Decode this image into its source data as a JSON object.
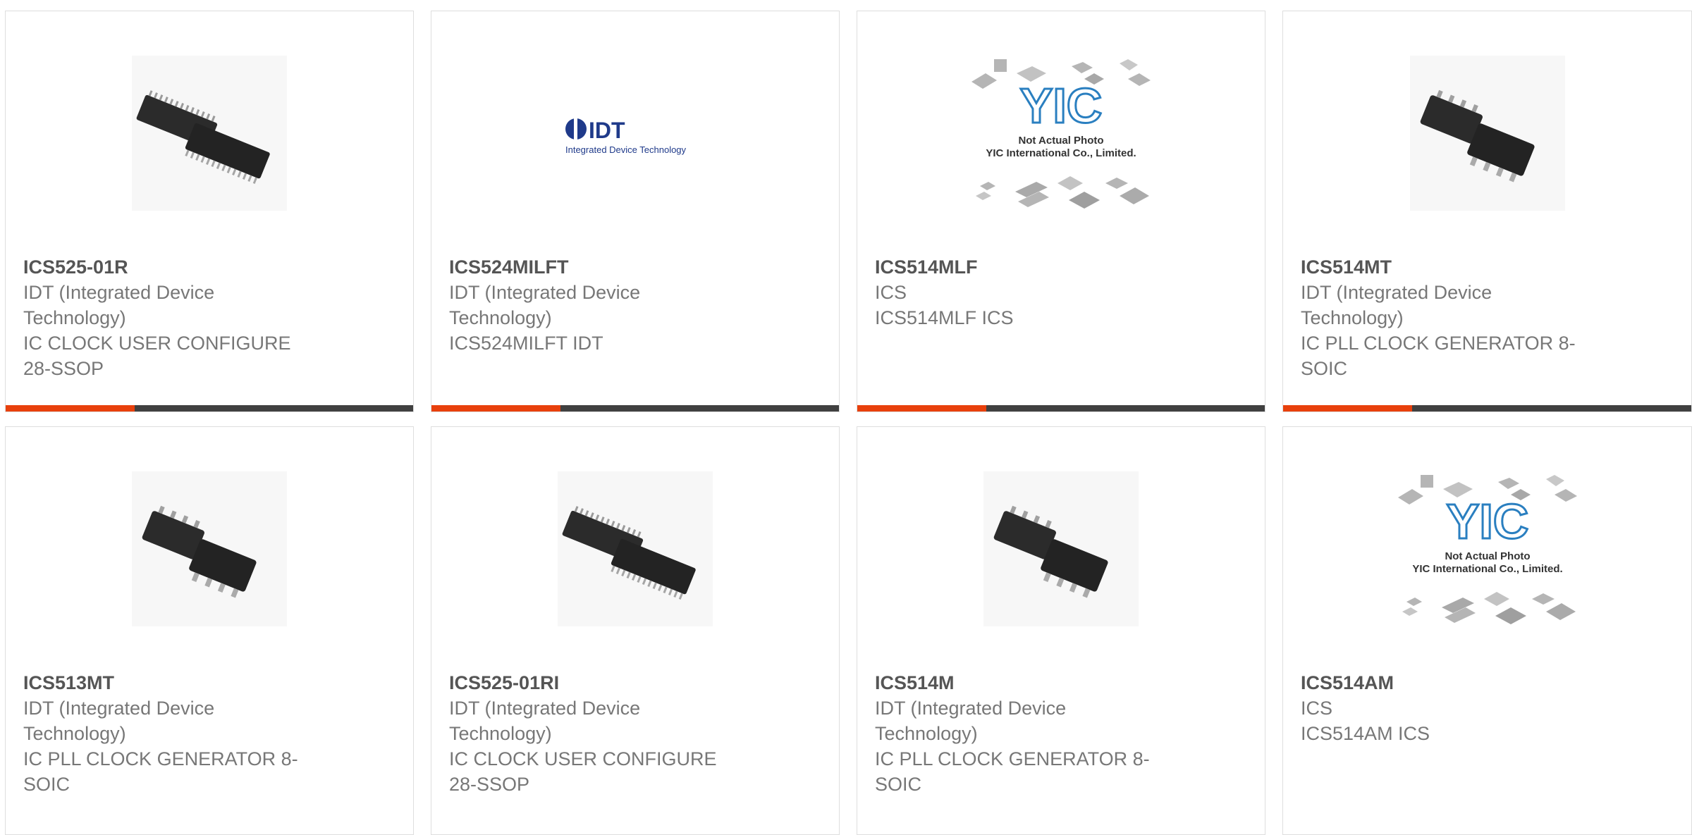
{
  "colors": {
    "accent": "#e8400c",
    "bar": "#404040",
    "title_text": "#555555",
    "body_text": "#777777",
    "border": "#dedede"
  },
  "cards": [
    {
      "part_number": "ICS525-01R",
      "manufacturer_line1": "IDT (Integrated Device",
      "manufacturer_line2": "Technology)",
      "description_line1": "IC CLOCK USER CONFIGURE",
      "description_line2": "28-SSOP",
      "image": "ssop-chip-image"
    },
    {
      "part_number": "ICS524MILFT",
      "manufacturer_line1": "IDT (Integrated Device",
      "manufacturer_line2": "Technology)",
      "description_line1": "ICS524MILFT IDT",
      "description_line2": "",
      "image": "idt-logo-image",
      "logo_text": "IDT",
      "logo_subtext": "Integrated Device Technology"
    },
    {
      "part_number": "ICS514MLF",
      "manufacturer_line1": "ICS",
      "manufacturer_line2": "ICS514MLF ICS",
      "description_line1": "",
      "description_line2": "",
      "image": "not-actual-photo-image",
      "placeholder_logo": "YIC",
      "placeholder_line1": "Not Actual Photo",
      "placeholder_line2": "YIC International Co., Limited."
    },
    {
      "part_number": "ICS514MT",
      "manufacturer_line1": "IDT (Integrated Device",
      "manufacturer_line2": "Technology)",
      "description_line1": "IC PLL CLOCK GENERATOR 8-",
      "description_line2": "SOIC",
      "image": "soic-chip-image"
    },
    {
      "part_number": "ICS513MT",
      "manufacturer_line1": "IDT (Integrated Device",
      "manufacturer_line2": "Technology)",
      "description_line1": "IC PLL CLOCK GENERATOR 8-",
      "description_line2": "SOIC",
      "image": "soic-chip-image"
    },
    {
      "part_number": "ICS525-01RI",
      "manufacturer_line1": "IDT (Integrated Device",
      "manufacturer_line2": "Technology)",
      "description_line1": "IC CLOCK USER CONFIGURE",
      "description_line2": "28-SSOP",
      "image": "ssop-chip-image"
    },
    {
      "part_number": "ICS514M",
      "manufacturer_line1": "IDT (Integrated Device",
      "manufacturer_line2": "Technology)",
      "description_line1": "IC PLL CLOCK GENERATOR 8-",
      "description_line2": "SOIC",
      "image": "soic-chip-image"
    },
    {
      "part_number": "ICS514AM",
      "manufacturer_line1": "ICS",
      "manufacturer_line2": "ICS514AM ICS",
      "description_line1": "",
      "description_line2": "",
      "image": "not-actual-photo-image",
      "placeholder_logo": "YIC",
      "placeholder_line1": "Not Actual Photo",
      "placeholder_line2": "YIC International Co., Limited."
    }
  ]
}
